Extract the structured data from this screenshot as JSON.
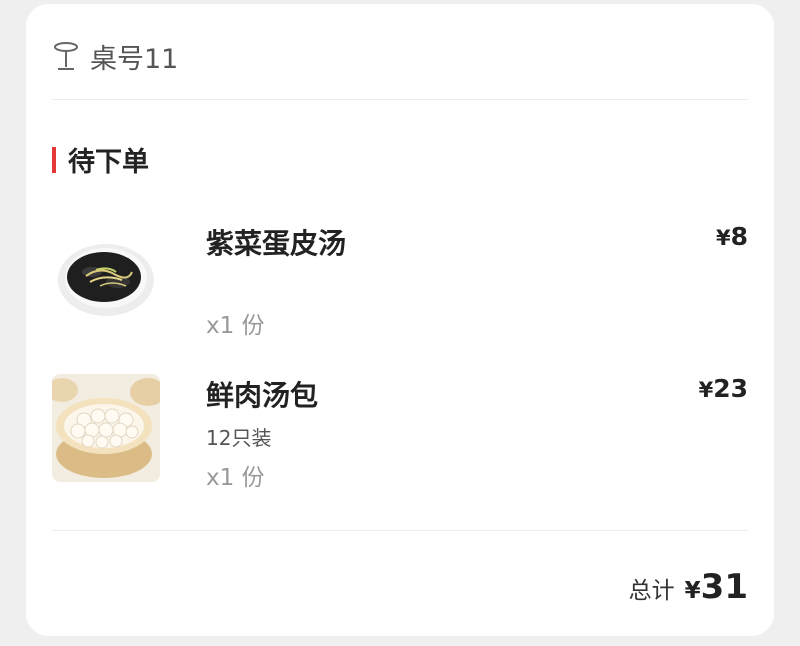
{
  "table": {
    "label": "桌号11",
    "icon": "table-icon"
  },
  "section": {
    "title": "待下单",
    "accent_color": "#e53935"
  },
  "items": [
    {
      "name": "紫菜蛋皮汤",
      "spec": "",
      "qty": "x1 份",
      "currency": "¥",
      "price": "8",
      "image": "seaweed-egg-soup"
    },
    {
      "name": "鲜肉汤包",
      "spec": "12只装",
      "qty": "x1 份",
      "currency": "¥",
      "price": "23",
      "image": "soup-dumplings"
    }
  ],
  "summary": {
    "label": "总计",
    "currency": "¥",
    "value": "31"
  }
}
